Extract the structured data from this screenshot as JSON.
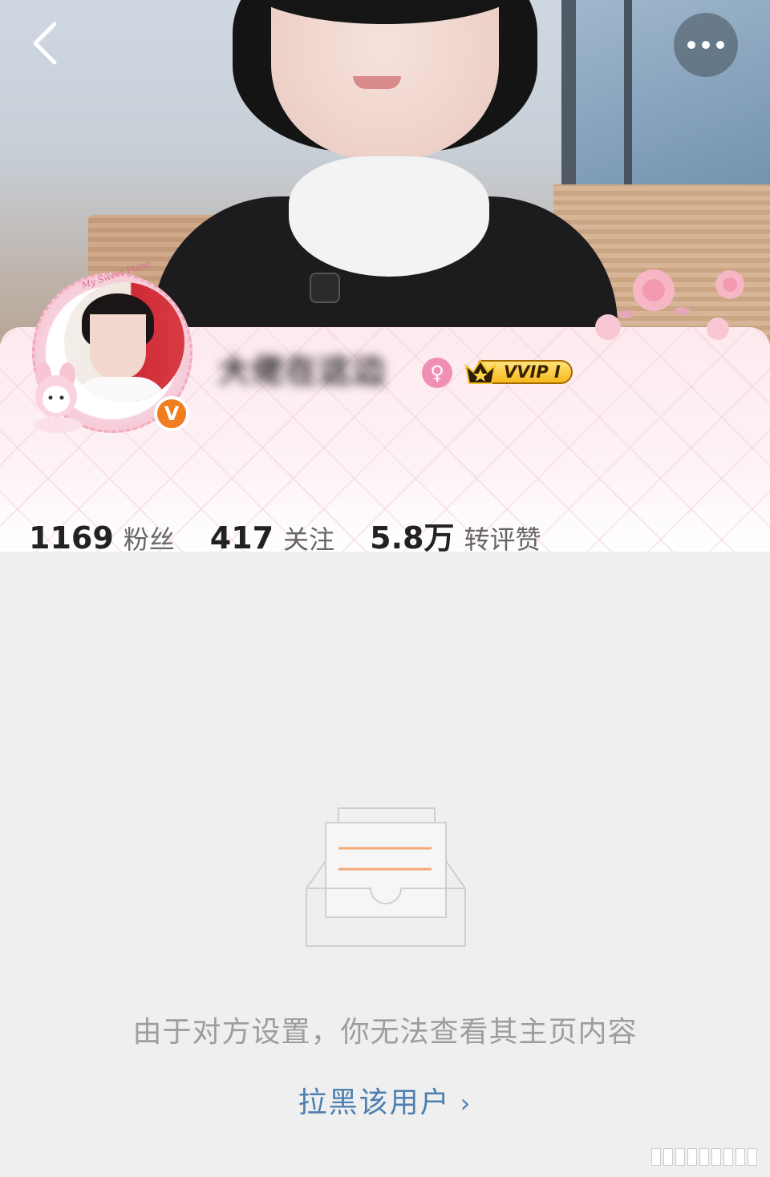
{
  "header": {
    "back_icon": "chevron-left-icon",
    "more_icon": "more-dots-icon"
  },
  "profile": {
    "username": "大佬在这边",
    "gender_icon": "female-icon",
    "gender_glyph": "♀",
    "vip_badge_label": "VVIP I",
    "verified_badge": "V",
    "avatar_frame_text": "My Sweet Piano"
  },
  "stats": [
    {
      "value": "1169",
      "label": "粉丝"
    },
    {
      "value": "417",
      "label": "关注"
    },
    {
      "value": "5.8万",
      "label": "转评赞"
    }
  ],
  "empty_state": {
    "icon": "empty-inbox-icon",
    "message": "由于对方设置，你无法查看其主页内容",
    "block_link_label": "拉黑该用户",
    "block_link_chevron": "›"
  },
  "colors": {
    "page_bg": "#efefef",
    "link": "#4e7fb0",
    "muted_text": "#9d9d9d",
    "verified_orange": "#f07d1f",
    "gender_pink": "#f08fb4",
    "vip_gold": "#f7b91c"
  }
}
